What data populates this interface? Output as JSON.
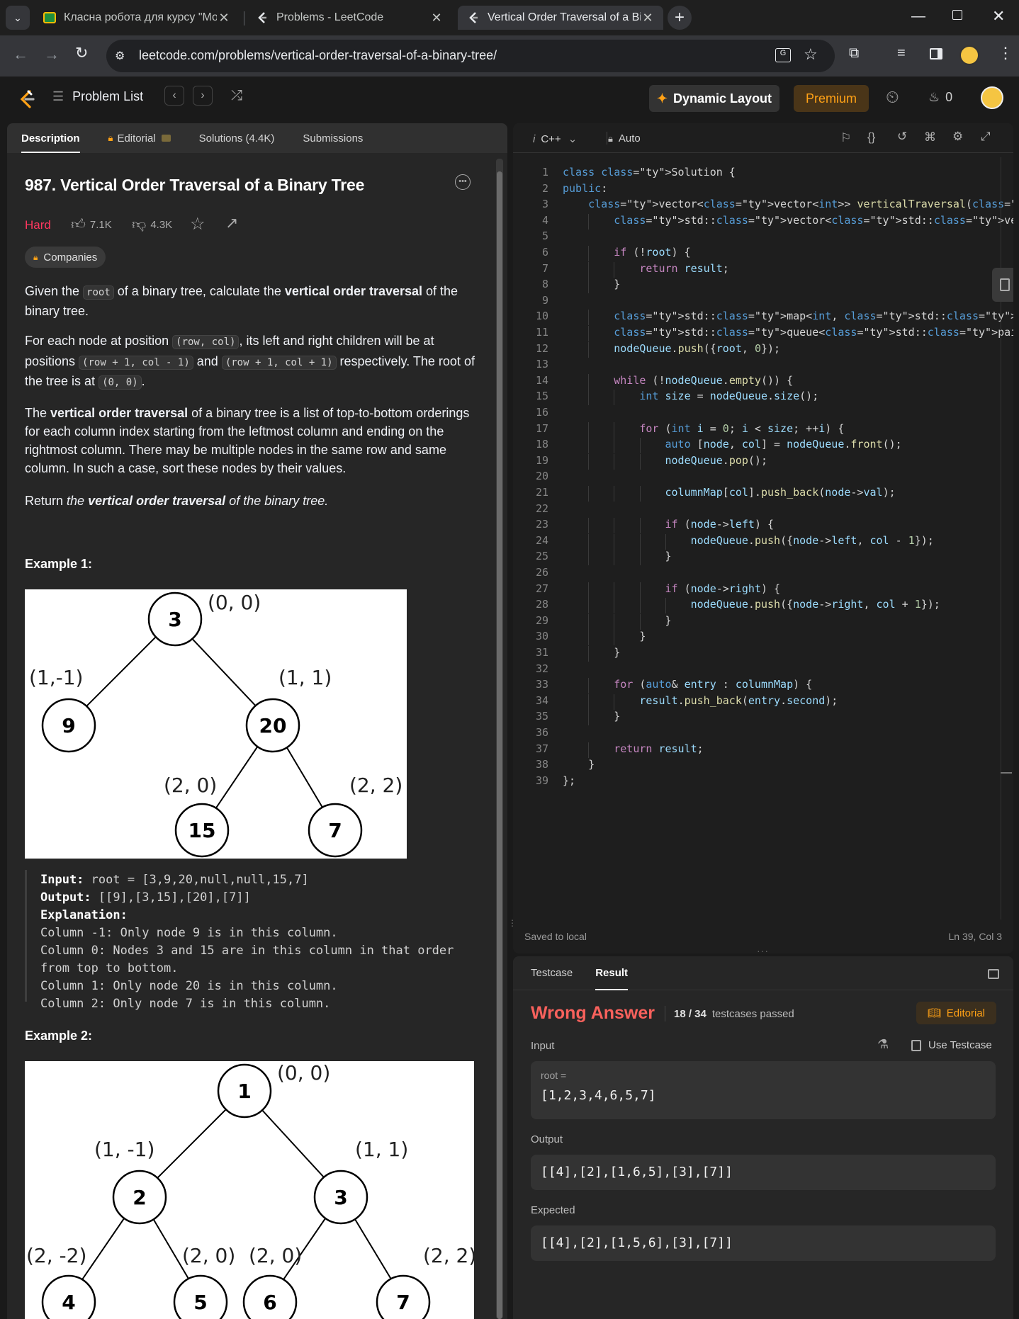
{
  "browser": {
    "tabs": [
      {
        "title": "Класна робота для курсу \"Мод",
        "icon": "classroom-icon"
      },
      {
        "title": "Problems - LeetCode",
        "icon": "leetcode-icon"
      },
      {
        "title": "Vertical Order Traversal of a Bin",
        "icon": "leetcode-icon"
      }
    ],
    "url": "leetcode.com/problems/vertical-order-traversal-of-a-binary-tree/"
  },
  "nav": {
    "problem_list": "Problem List",
    "dynamic_layout": "Dynamic Layout",
    "premium": "Premium",
    "streak": "0"
  },
  "left_tabs": [
    "Description",
    "Editorial",
    "Solutions (4.4K)",
    "Submissions"
  ],
  "problem": {
    "title": "987. Vertical Order Traversal of a Binary Tree",
    "difficulty": "Hard",
    "likes": "7.1K",
    "dislikes": "4.3K",
    "companies": "Companies"
  },
  "desc": {
    "p1a": "Given the ",
    "p1code": "root",
    "p1b": " of a binary tree, calculate the ",
    "p1bold": "vertical order traversal",
    "p1c": " of the binary tree.",
    "p2a": "For each node at position ",
    "p2c1": "(row, col)",
    "p2b": ", its left and right children will be at positions ",
    "p2c2": "(row + 1, col - 1)",
    "p2and": " and ",
    "p2c3": "(row + 1, col + 1)",
    "p2d": " respectively. The root of the tree is at ",
    "p2c4": "(0, 0)",
    "p2e": ".",
    "p3a": "The ",
    "p3bold": "vertical order traversal",
    "p3b": " of a binary tree is a list of top-to-bottom orderings for each column index starting from the leftmost column and ending on the rightmost column. There may be multiple nodes in the same row and same column. In such a case, sort these nodes by their values.",
    "p4a": "Return ",
    "p4i": "the ",
    "p4bold": "vertical order traversal",
    "p4c": " of the binary tree.",
    "ex1": "Example 1:",
    "ex2": "Example 2:"
  },
  "example1": {
    "input_label": "Input:",
    "input": " root = [3,9,20,null,null,15,7]",
    "output_label": "Output:",
    "output": " [[9],[3,15],[20],[7]]",
    "expl_label": "Explanation:",
    "lines": [
      "Column -1: Only node 9 is in this column.",
      "Column 0: Nodes 3 and 15 are in this column in that order",
      "from top to bottom.",
      "Column 1: Only node 20 is in this column.",
      "Column 2: Only node 7 is in this column."
    ],
    "tree_nodes": [
      "3",
      "9",
      "20",
      "15",
      "7"
    ],
    "tree_labels": [
      "(0, 0)",
      "(1,-1)",
      "(1, 1)",
      "(2, 0)",
      "(2, 2)"
    ]
  },
  "example2": {
    "tree_nodes": [
      "1",
      "2",
      "3",
      "4",
      "5",
      "6",
      "7"
    ],
    "tree_labels": [
      "(0, 0)",
      "(1, -1)",
      "(1, 1)",
      "(2, -2)",
      "(2, 0)",
      "(2, 0)",
      "(2, 2)"
    ]
  },
  "editor": {
    "language": "C++",
    "mode": "Auto",
    "status": "Saved to local",
    "cursor": "Ln 39, Col 3",
    "code": [
      "class Solution {",
      "public:",
      "    vector<vector<int>> verticalTraversal(TreeNode* root) {",
      "        std::vector<std::vector<int>> result;",
      "",
      "        if (!root) {",
      "            return result;",
      "        }",
      "",
      "        std::map<int, std::vector<int>> columnMap;",
      "        std::queue<std::pair<TreeNode*, int>> nodeQueue;",
      "        nodeQueue.push({root, 0});",
      "",
      "        while (!nodeQueue.empty()) {",
      "            int size = nodeQueue.size();",
      "",
      "            for (int i = 0; i < size; ++i) {",
      "                auto [node, col] = nodeQueue.front();",
      "                nodeQueue.pop();",
      "",
      "                columnMap[col].push_back(node->val);",
      "",
      "                if (node->left) {",
      "                    nodeQueue.push({node->left, col - 1});",
      "                }",
      "",
      "                if (node->right) {",
      "                    nodeQueue.push({node->right, col + 1});",
      "                }",
      "            }",
      "        }",
      "",
      "        for (auto& entry : columnMap) {",
      "            result.push_back(entry.second);",
      "        }",
      "",
      "        return result;",
      "    }",
      "};"
    ]
  },
  "result": {
    "tabs": [
      "Testcase",
      "Result"
    ],
    "verdict": "Wrong Answer",
    "passed": "18 / 34",
    "passed_suffix": "testcases passed",
    "editorial": "Editorial",
    "input_label": "Input",
    "use_testcase": "Use Testcase",
    "input_var": "root =",
    "input_val": "[1,2,3,4,6,5,7]",
    "output_label": "Output",
    "output_val": "[[4],[2],[1,6,5],[3],[7]]",
    "expected_label": "Expected",
    "expected_val": "[[4],[2],[1,5,6],[3],[7]]"
  },
  "colors": {
    "hard": "#ff375f",
    "wrong": "#f8615c",
    "premium": "#ffa116"
  }
}
